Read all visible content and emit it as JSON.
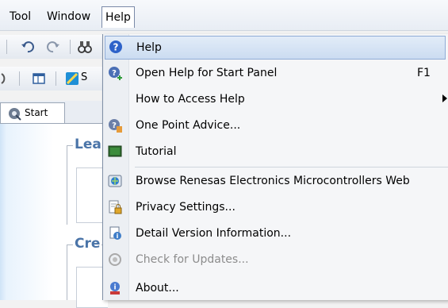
{
  "menubar": {
    "tool": "Tool",
    "window": "Window",
    "help": "Help"
  },
  "toolbar2": {
    "partial_label": "S"
  },
  "tab": {
    "label": "Start"
  },
  "panel": {
    "group1_title": "Lea",
    "group2_title": "Cre"
  },
  "help_menu": {
    "items": [
      {
        "label": "Help",
        "shortcut": "",
        "icon": "help-question-icon"
      },
      {
        "label": "Open Help for Start Panel",
        "shortcut": "F1",
        "icon": "help-plus-icon"
      },
      {
        "label": "How to Access Help",
        "shortcut": "",
        "icon": "",
        "submenu": true
      },
      {
        "label": "One Point Advice...",
        "shortcut": "",
        "icon": "advice-icon"
      },
      {
        "label": "Tutorial",
        "shortcut": "",
        "icon": "tutorial-icon"
      },
      {
        "label": "Browse Renesas Electronics Microcontrollers Web",
        "shortcut": "",
        "icon": "web-globe-icon"
      },
      {
        "label": "Privacy Settings...",
        "shortcut": "",
        "icon": "privacy-lock-icon"
      },
      {
        "label": "Detail Version Information...",
        "shortcut": "",
        "icon": "version-info-icon"
      },
      {
        "label": "Check for Updates...",
        "shortcut": "",
        "icon": "update-check-icon",
        "disabled": true
      },
      {
        "label": "About...",
        "shortcut": "",
        "icon": "about-icon"
      }
    ]
  }
}
